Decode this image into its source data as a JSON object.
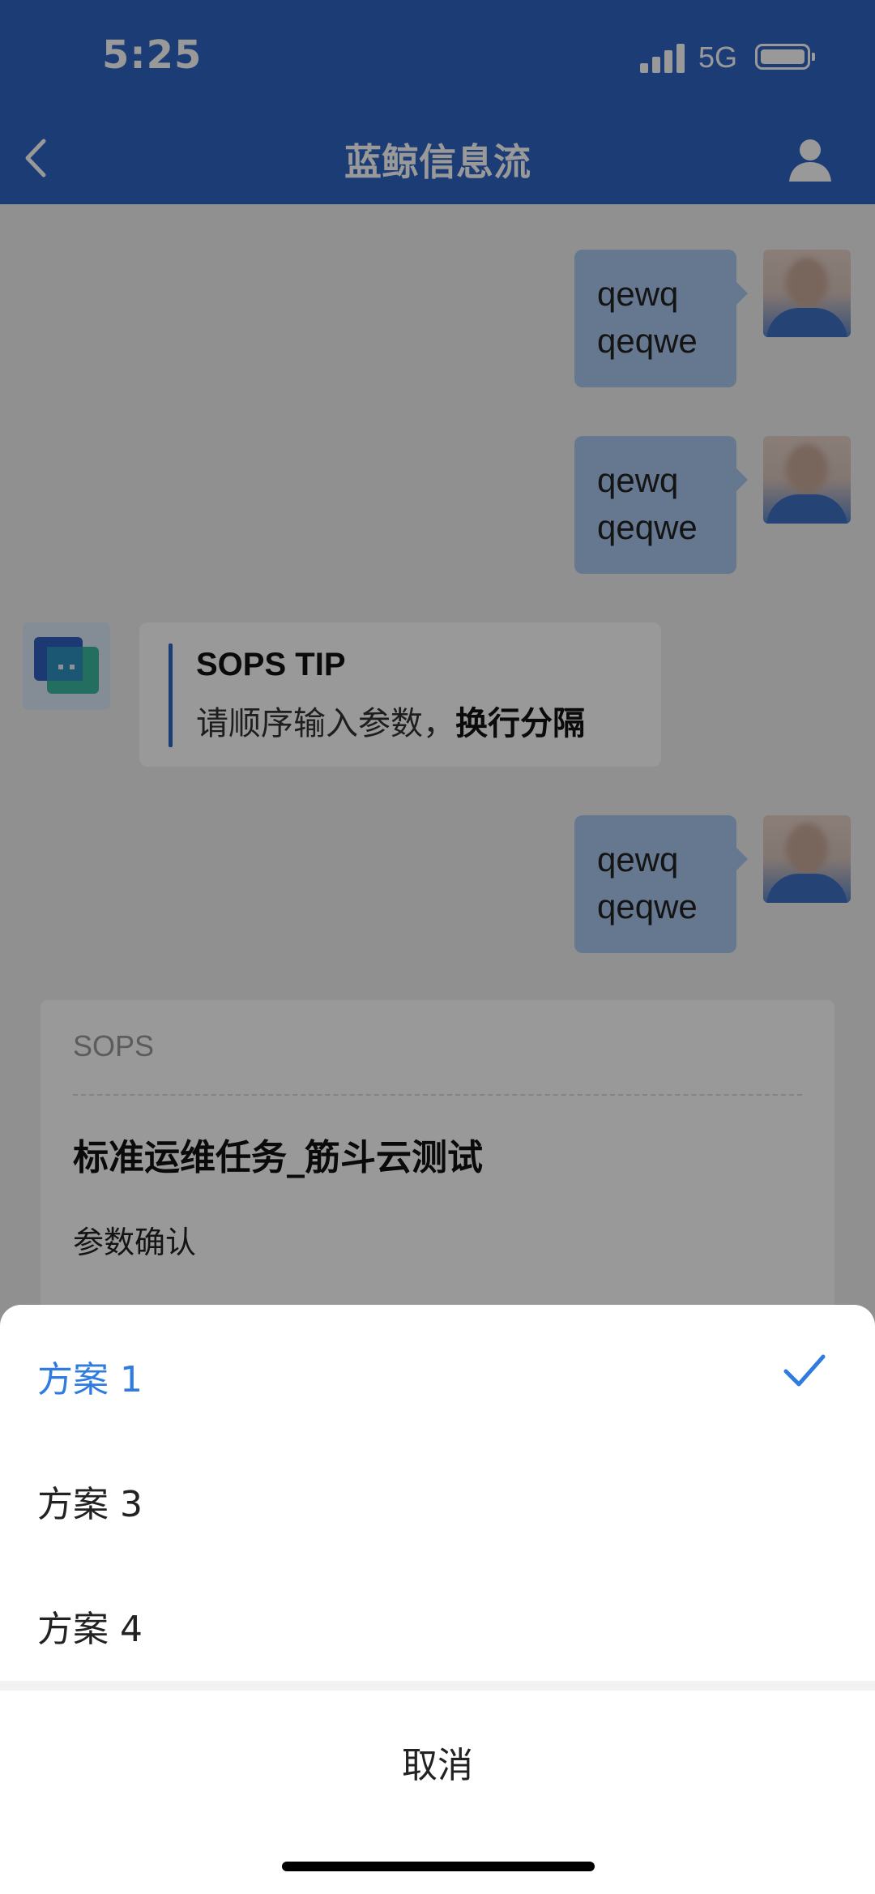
{
  "status_bar": {
    "time": "5:25",
    "network": "5G"
  },
  "nav": {
    "title": "蓝鲸信息流"
  },
  "messages": [
    {
      "line1": "qewq",
      "line2": "qeqwe"
    },
    {
      "line1": "qewq",
      "line2": "qeqwe"
    },
    {
      "line1": "qewq",
      "line2": "qeqwe"
    }
  ],
  "tip": {
    "title": "SOPS TIP",
    "text": "请顺序输入参数，",
    "text_bold": "换行分隔"
  },
  "card": {
    "label": "SOPS",
    "title": "标准运维任务_筋斗云测试",
    "subtitle": "参数确认"
  },
  "sheet": {
    "options": [
      {
        "label": "方案 1",
        "selected": true
      },
      {
        "label": "方案 3",
        "selected": false
      },
      {
        "label": "方案 4",
        "selected": false
      }
    ],
    "cancel": "取消"
  },
  "colors": {
    "accent": "#2f64c4",
    "selected": "#2f7be0",
    "bubble": "#a8c8f0"
  }
}
